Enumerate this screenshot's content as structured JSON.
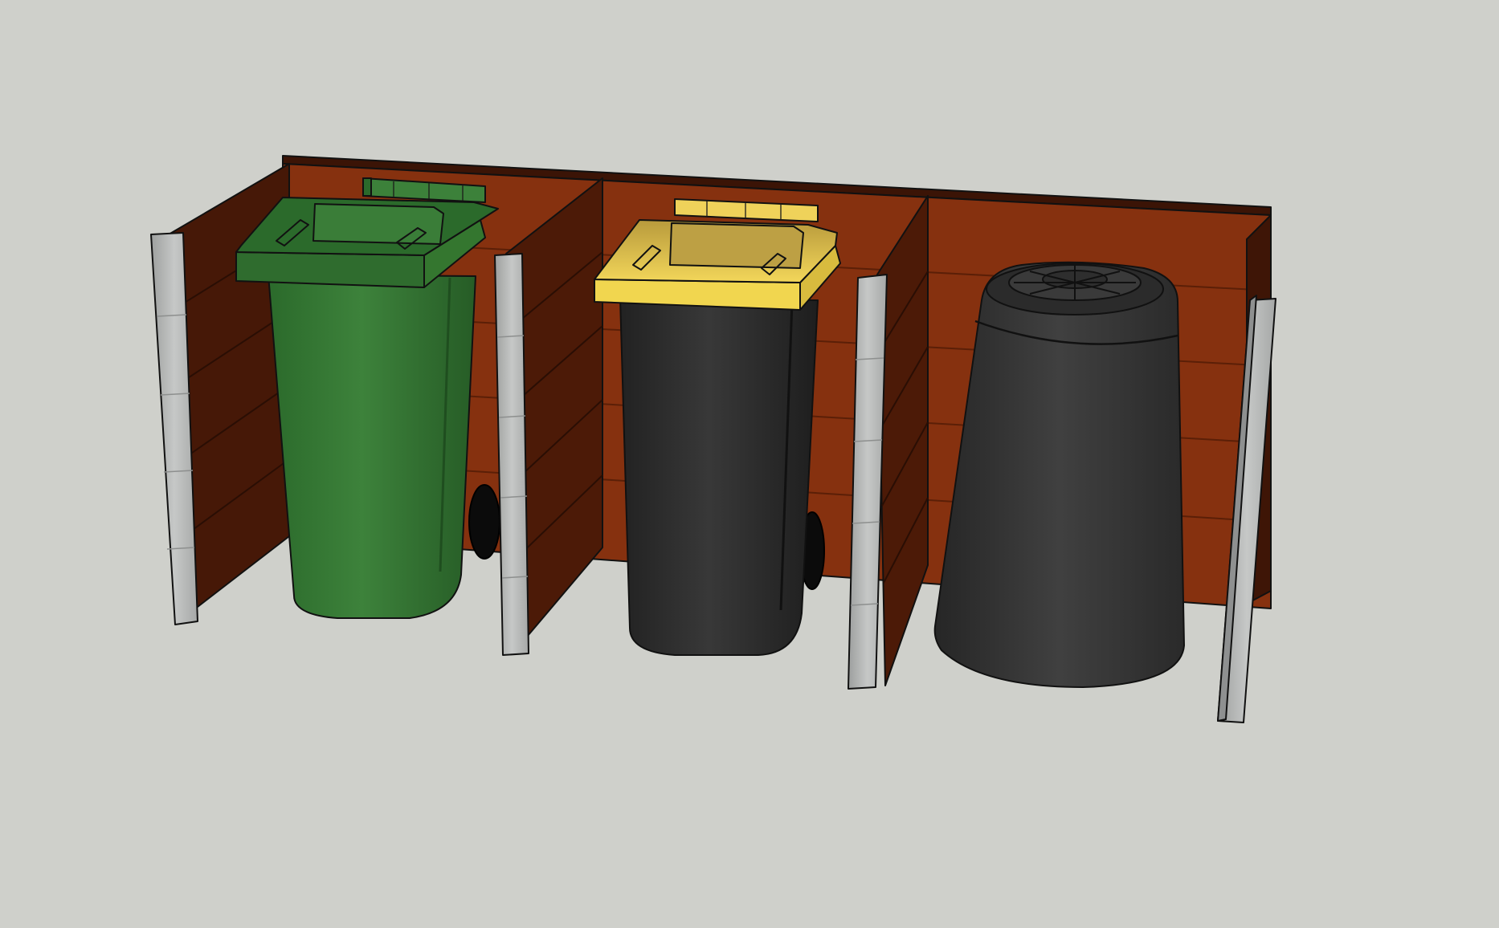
{
  "scene": {
    "background_color": "#cfd0cb",
    "enclosure": {
      "fence_color": "#86310f",
      "fence_shadow_color": "#4a1a08",
      "post_color": "#bdbfbe",
      "compartments": 3,
      "fence_board_rows": 5
    },
    "items": [
      {
        "kind": "wheelie-bin",
        "body_color": "#3a7a3a",
        "lid_color": "#3c813a",
        "compartment": 1
      },
      {
        "kind": "wheelie-bin",
        "body_color": "#303030",
        "lid_color": "#e9c94e",
        "compartment": 2
      },
      {
        "kind": "compost-bin",
        "body_color": "#333333",
        "compartment": 3
      }
    ]
  }
}
